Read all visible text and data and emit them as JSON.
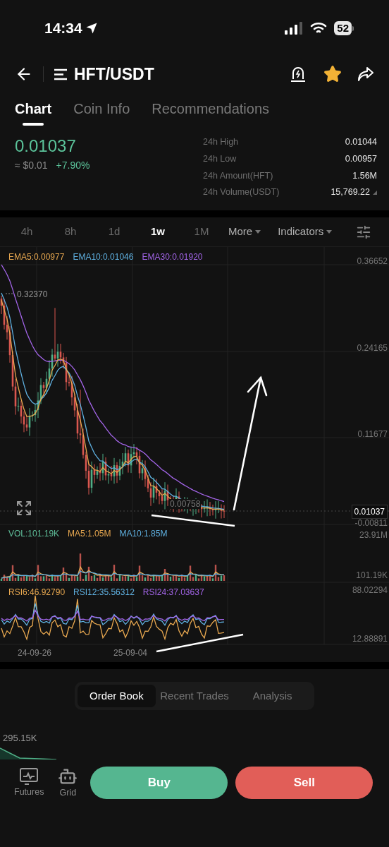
{
  "status_bar": {
    "time": "14:34",
    "battery": "52"
  },
  "header": {
    "pair": "HFT/USDT",
    "favorite": true
  },
  "tabs": [
    {
      "label": "Chart",
      "selected": true
    },
    {
      "label": "Coin Info",
      "selected": false
    },
    {
      "label": "Recommendations",
      "selected": false
    }
  ],
  "ticker": {
    "price": "0.01037",
    "fiat": "≈ $0.01",
    "change": "+7.90%",
    "stats": [
      {
        "label": "24h High",
        "value": "0.01044"
      },
      {
        "label": "24h Low",
        "value": "0.00957"
      },
      {
        "label": "24h Amount(HFT)",
        "value": "1.56M"
      },
      {
        "label": "24h Volume(USDT)",
        "value": "15,769.22"
      }
    ]
  },
  "intervals": [
    {
      "label": "4h",
      "selected": false
    },
    {
      "label": "8h",
      "selected": false
    },
    {
      "label": "1d",
      "selected": false
    },
    {
      "label": "1w",
      "selected": true
    },
    {
      "label": "1M",
      "selected": false
    }
  ],
  "menus": [
    "More",
    "Indicators"
  ],
  "chart": {
    "legend": [
      {
        "label": "EMA5:0.00977",
        "color": "#e8a850"
      },
      {
        "label": "EMA10:0.01046",
        "color": "#5fb0e0"
      },
      {
        "label": "EMA30:0.01920",
        "color": "#a365e8"
      }
    ],
    "price_axis": [
      "0.36652",
      "0.24165",
      "0.11677",
      "-0.00811"
    ],
    "high_marker": "0.32370",
    "low_marker": "0.00758",
    "last_price": "0.01037",
    "volume_legend": [
      {
        "label": "VOL:101.19K",
        "color": "#5fbf9a"
      },
      {
        "label": "MA5:1.05M",
        "color": "#e8a850"
      },
      {
        "label": "MA10:1.85M",
        "color": "#5fb0e0"
      }
    ],
    "volume_axis": [
      "23.91M",
      "101.19K"
    ],
    "rsi_legend": [
      {
        "label": "RSI6:46.92790",
        "color": "#e8a850"
      },
      {
        "label": "RSI12:35.56312",
        "color": "#5fb0e0"
      },
      {
        "label": "RSI24:37.03637",
        "color": "#a365e8"
      }
    ],
    "rsi_axis": [
      "88.02294",
      "12.88891"
    ],
    "dates": [
      "24-09-26",
      "25-09-04"
    ]
  },
  "order_tabs": [
    {
      "label": "Order Book",
      "selected": true
    },
    {
      "label": "Recent Trades",
      "selected": false
    },
    {
      "label": "Analysis",
      "selected": false
    }
  ],
  "depth": {
    "label": "295.15K"
  },
  "shortcuts": [
    {
      "kind": "futures",
      "label": "Futures"
    },
    {
      "kind": "grid",
      "label": "Grid"
    }
  ],
  "actions": {
    "buy": "Buy",
    "sell": "Sell"
  }
}
